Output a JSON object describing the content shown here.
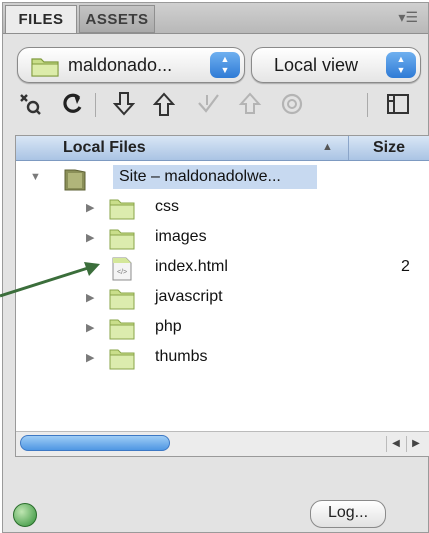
{
  "tabs": [
    {
      "label": "FILES"
    },
    {
      "label": "ASSETS"
    }
  ],
  "site_select": {
    "value": "maldonado..."
  },
  "view_select": {
    "value": "Local view"
  },
  "toolbar": {
    "icons": [
      "connect-icon",
      "refresh-icon",
      "get-icon",
      "put-icon",
      "check-out-icon",
      "check-in-icon",
      "sync-icon",
      "expand-icon"
    ]
  },
  "tree": {
    "columns": [
      "Local Files",
      "Size"
    ],
    "sort_indicator": "▲",
    "rows": [
      {
        "name": "Site – maldonadolwe...",
        "size": "",
        "type": "site",
        "expanded": true,
        "selected": true
      },
      {
        "name": "css",
        "size": "",
        "type": "folder"
      },
      {
        "name": "images",
        "size": "",
        "type": "folder"
      },
      {
        "name": "index.html",
        "size": "2",
        "type": "file"
      },
      {
        "name": "javascript",
        "size": "",
        "type": "folder"
      },
      {
        "name": "php",
        "size": "",
        "type": "folder"
      },
      {
        "name": "thumbs",
        "size": "",
        "type": "folder"
      }
    ]
  },
  "footer": {
    "log_label": "Log..."
  },
  "colors": {
    "selection": "#c7d9f0",
    "arrow": "#3b6e3b",
    "folder": "#c9de8a",
    "accent": "#3f8be0"
  }
}
